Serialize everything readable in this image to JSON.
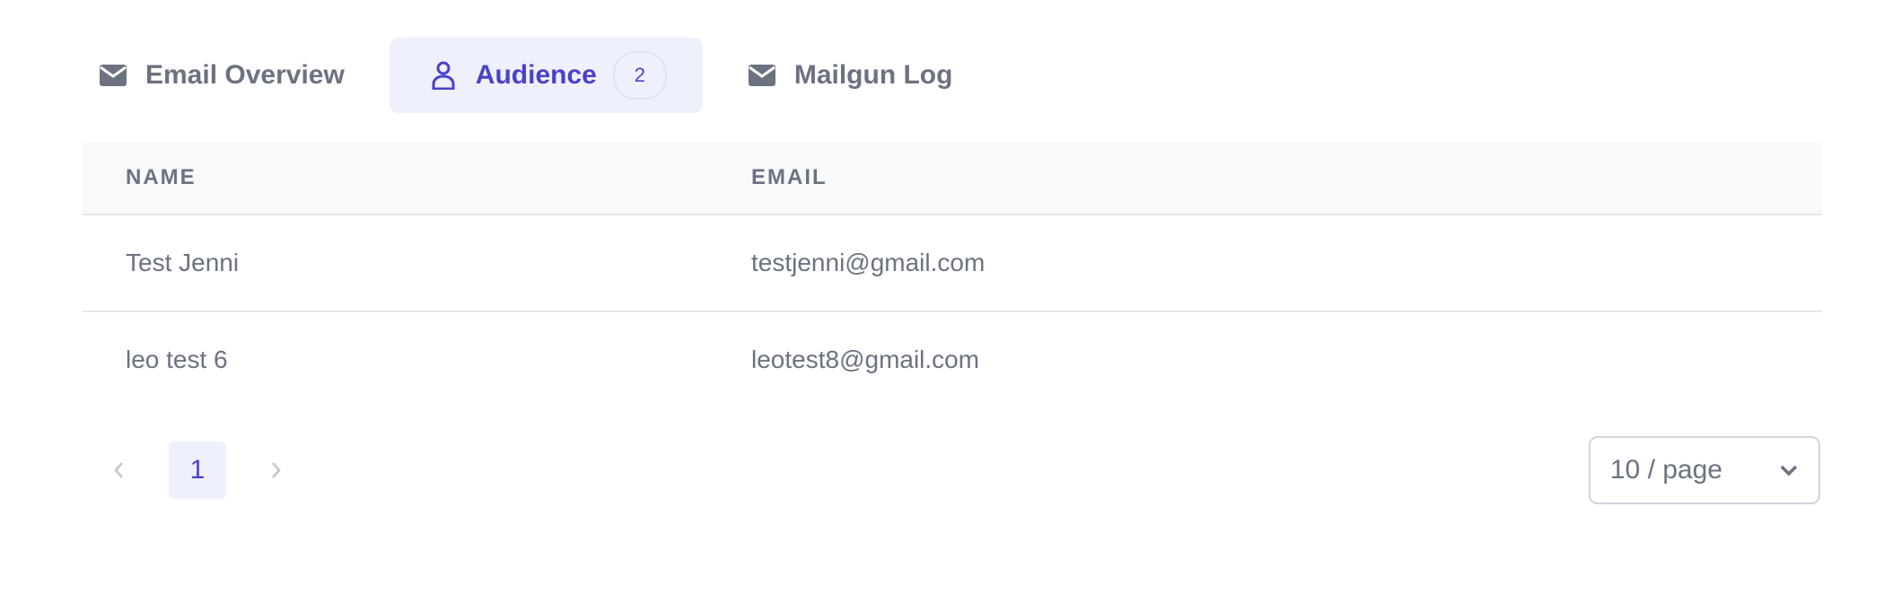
{
  "tabs": [
    {
      "label": "Email Overview",
      "icon": "envelope-icon",
      "active": false
    },
    {
      "label": "Audience",
      "icon": "user-icon",
      "active": true,
      "count": "2"
    },
    {
      "label": "Mailgun Log",
      "icon": "envelope-icon",
      "active": false
    }
  ],
  "table": {
    "columns": [
      "NAME",
      "EMAIL"
    ],
    "rows": [
      {
        "name": "Test Jenni",
        "email": "testjenni@gmail.com"
      },
      {
        "name": "leo test 6",
        "email": "leotest8@gmail.com"
      }
    ]
  },
  "pagination": {
    "current_page": "1",
    "prev_icon": "chevron-left-icon",
    "next_icon": "chevron-right-icon",
    "page_size_label": "10 / page",
    "dropdown_icon": "chevron-down-icon"
  },
  "colors": {
    "accent": "#4a42c9",
    "accent_bg": "#eef0fc",
    "text_muted": "#6b7280",
    "header_bg": "#f8f9fb",
    "border": "#e5e7eb"
  }
}
